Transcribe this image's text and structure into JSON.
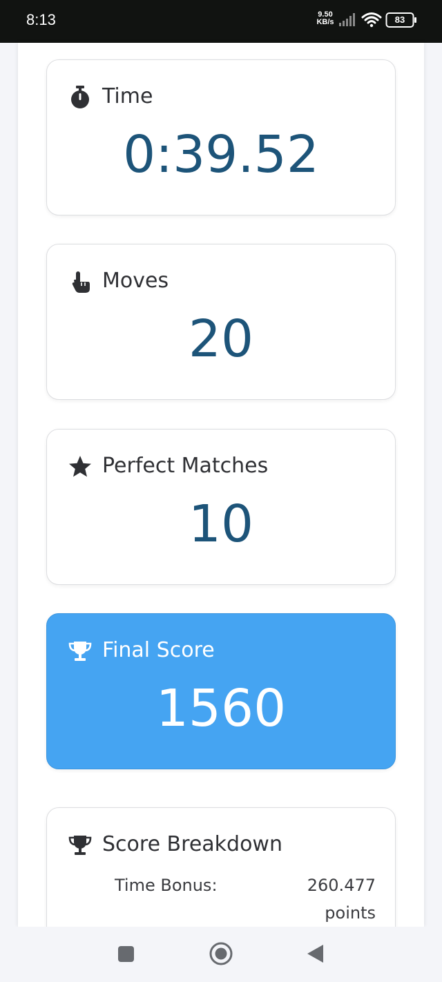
{
  "status_bar": {
    "time": "8:13",
    "net_speed_value": "9.50",
    "net_speed_unit": "KB/s",
    "battery": "83",
    "icons": [
      "signal-icon",
      "wifi-icon",
      "battery-icon"
    ]
  },
  "stats": {
    "time": {
      "label": "Time",
      "value": "0:39.52",
      "icon": "stopwatch-icon"
    },
    "moves": {
      "label": "Moves",
      "value": "20",
      "icon": "hand-pointer-icon"
    },
    "perfect_matches": {
      "label": "Perfect Matches",
      "value": "10",
      "icon": "star-icon"
    },
    "final_score": {
      "label": "Final Score",
      "value": "1560",
      "icon": "trophy-icon"
    }
  },
  "breakdown": {
    "title": "Score Breakdown",
    "icon": "trophy-icon",
    "rows": [
      {
        "label": "Time Bonus:",
        "value": "260.477",
        "unit": "points"
      }
    ]
  },
  "nav": {
    "icons": [
      "recents-square-icon",
      "home-circle-icon",
      "back-triangle-icon"
    ]
  },
  "colors": {
    "status_bar_bg": "#111311",
    "value_text": "#1d5479",
    "final_score_bg": "#45a4f2",
    "page_bg": "#f4f5f9"
  }
}
